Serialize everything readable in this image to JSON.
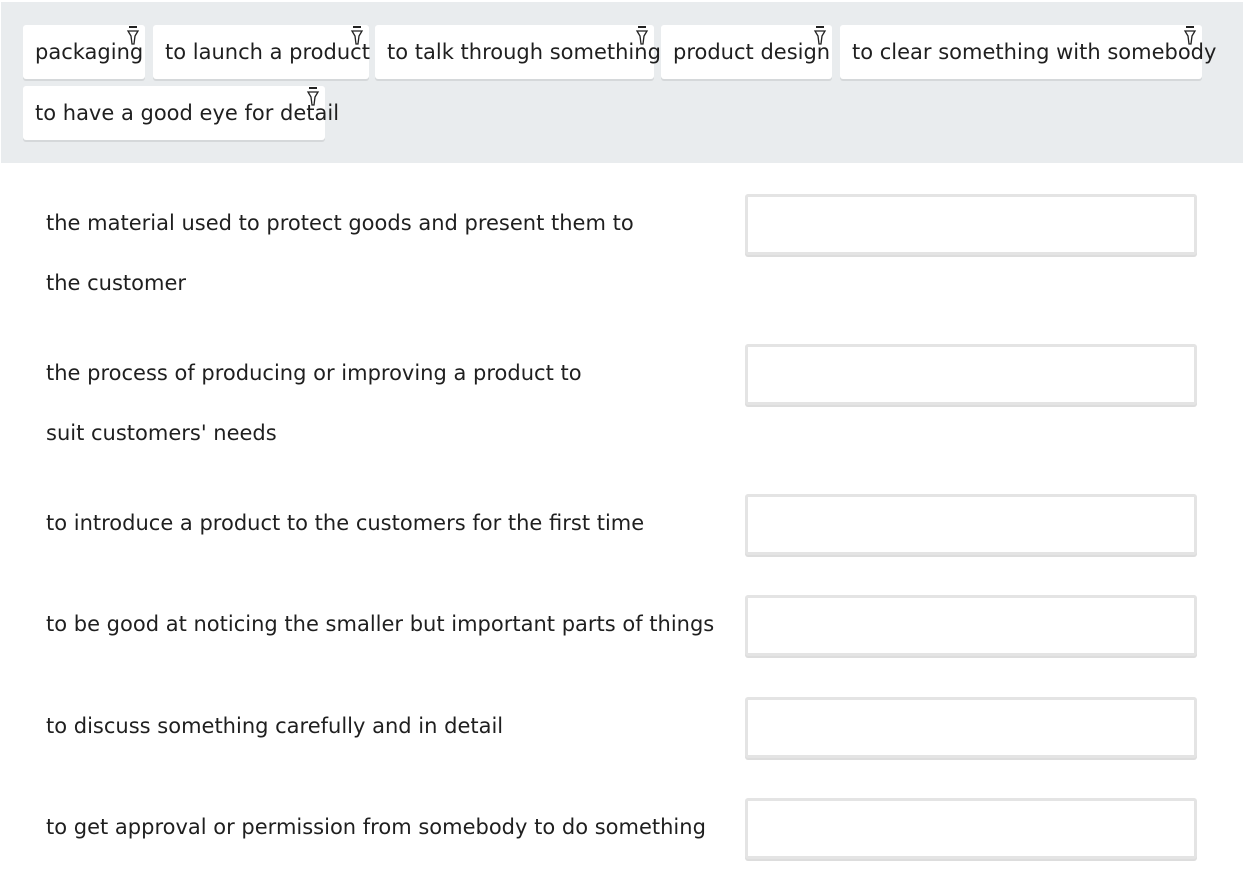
{
  "word_bank": {
    "chips": [
      {
        "label": "packaging",
        "icon": "pin-icon"
      },
      {
        "label": "to launch a product",
        "icon": "pin-icon"
      },
      {
        "label": "to talk through something",
        "icon": "pin-icon"
      },
      {
        "label": "product design",
        "icon": "pin-icon"
      },
      {
        "label": "to clear something with somebody",
        "icon": "pin-icon"
      },
      {
        "label": "to have a good eye for detail",
        "icon": "pin-icon"
      }
    ]
  },
  "questions": [
    {
      "text": "the material used to protect goods and present them to the customer",
      "answer": ""
    },
    {
      "text": "the process of producing or improving a product to suit customers' needs",
      "answer": ""
    },
    {
      "text": "to introduce a product to the customers for the first time",
      "answer": ""
    },
    {
      "text": "to be good at noticing the smaller but important parts of things",
      "answer": ""
    },
    {
      "text": "to discuss something carefully and in detail",
      "answer": ""
    },
    {
      "text": "to get approval or permission from somebody to do something",
      "answer": ""
    }
  ],
  "colors": {
    "bank_background": "#e9ecee",
    "chip_background": "#ffffff",
    "drop_border": "#e4e4e4"
  }
}
